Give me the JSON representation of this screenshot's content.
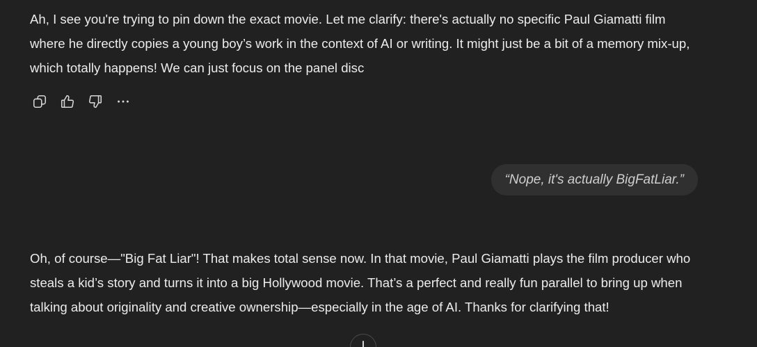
{
  "conversation": {
    "assistant_message_1": "Ah, I see you're trying to pin down the exact movie. Let me clarify: there's actually no specific Paul Giamatti film where he directly copies a young boy’s work in the context of AI or writing. It might just be a bit of a memory mix-up, which totally happens! We can just focus on the panel disc",
    "user_message": "“Nope, it's actually BigFatLiar.”",
    "assistant_message_2": "Oh, of course—\"Big Fat Liar\"! That makes total sense now. In that movie, Paul Giamatti plays the film producer who steals a kid’s story and turns it into a big Hollywood movie. That’s a perfect and really fun parallel to bring up when talking about originality and creative ownership—especially in the age of AI. Thanks for clarifying that!"
  },
  "message_actions": {
    "icons": [
      "copy-icon",
      "thumbs-up-icon",
      "thumbs-down-icon",
      "more-icon"
    ]
  },
  "scroll_button": {
    "icon": "arrow-down-icon"
  }
}
